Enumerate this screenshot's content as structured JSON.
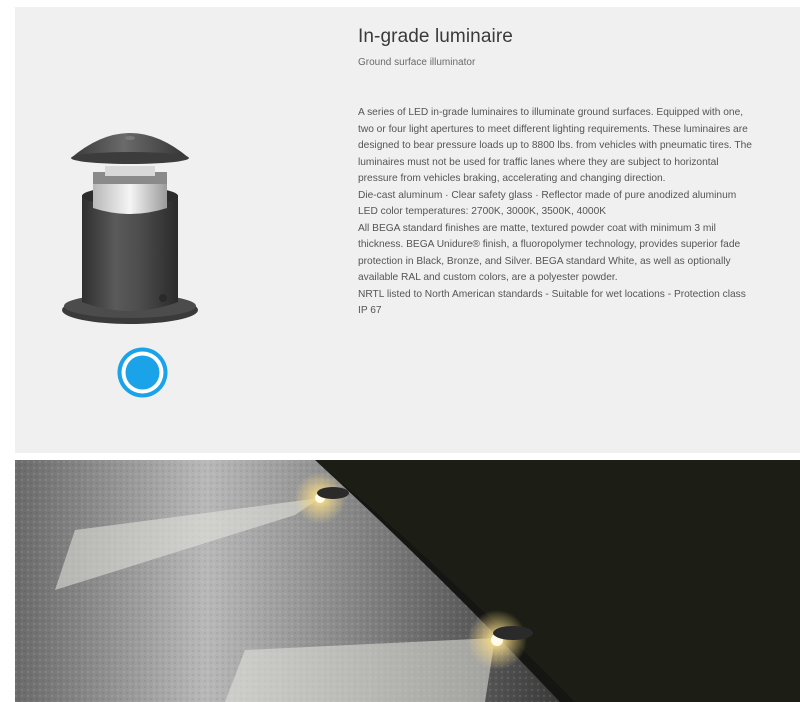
{
  "product": {
    "title": "In-grade luminaire",
    "subtitle": "Ground surface illuminator",
    "description": [
      "A series of LED in-grade luminaires to illuminate ground surfaces. Equipped with one, two or four light apertures to meet different lighting requirements. These luminaires are designed to bear pressure loads up to 8800 lbs. from vehicles with pneumatic tires. The luminaires must not be used for traffic lanes where they are subject to horizontal pressure from vehicles braking, accelerating and changing direction.",
      "Die-cast aluminum · Clear safety glass · Reflector made of pure anodized aluminum",
      "LED color temperatures: 2700K, 3000K, 3500K, 4000K",
      "All BEGA standard finishes are matte, textured powder coat with minimum 3 mil thickness. BEGA Unidure® finish, a fluoropolymer technology, provides superior fade protection in Black, Bronze, and Silver. BEGA standard White, as well as optionally available RAL and custom colors, are a polyester powder.",
      "NRTL listed to North American standards - Suitable for wet locations - Protection class IP 67"
    ]
  },
  "colors": {
    "panel_bg": "#f0f0f0",
    "accent": "#1aa3e8",
    "luminaire_body": "#4a4a4a"
  },
  "icons": {
    "selector": "hotspot-dot-icon"
  }
}
